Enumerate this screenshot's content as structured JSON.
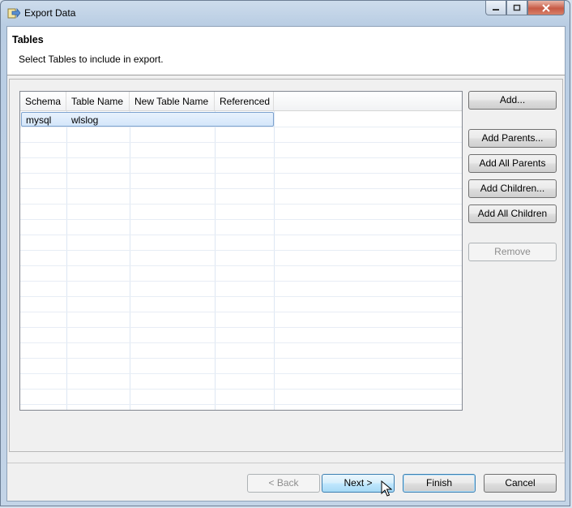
{
  "window": {
    "title": "Export Data"
  },
  "header": {
    "title": "Tables",
    "description": "Select Tables to include in export."
  },
  "table": {
    "columns": [
      "Schema",
      "Table Name",
      "New Table Name",
      "Referenced"
    ],
    "rows": [
      {
        "schema": "mysql",
        "table_name": "wlslog",
        "new_table_name": "",
        "referenced": ""
      }
    ]
  },
  "side_buttons": {
    "add": "Add...",
    "add_parents": "Add Parents...",
    "add_all_parents": "Add All Parents",
    "add_children": "Add Children...",
    "add_all_children": "Add All Children",
    "remove": "Remove"
  },
  "footer": {
    "back": "< Back",
    "next": "Next >",
    "finish": "Finish",
    "cancel": "Cancel"
  }
}
